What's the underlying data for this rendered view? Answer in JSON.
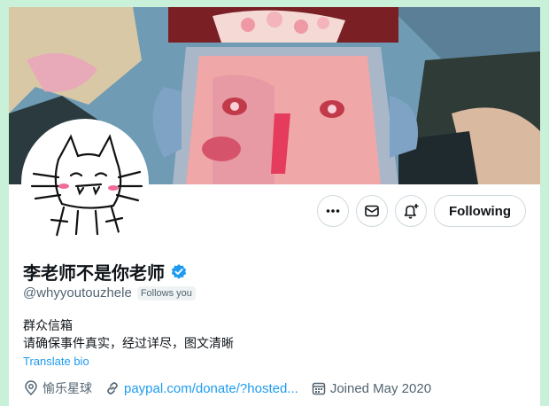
{
  "profile": {
    "display_name": "李老师不是你老师",
    "handle": "@whyyoutouzhele",
    "follows_you": "Follows you",
    "bio_line1": "群众信箱",
    "bio_line2": "请确保事件真实，经过详尽，图文清晰",
    "translate_label": "Translate bio",
    "location": "愉乐星球",
    "link": "paypal.com/donate/?hosted...",
    "joined": "Joined May 2020",
    "verified": true
  },
  "actions": {
    "more_icon": "more-horizontal-icon",
    "message_icon": "envelope-icon",
    "notify_icon": "bell-plus-icon",
    "following_label": "Following"
  },
  "colors": {
    "accent": "#1d9bf0",
    "page_bg": "#c9f0d8",
    "text_primary": "#0f1419",
    "text_secondary": "#536471"
  }
}
